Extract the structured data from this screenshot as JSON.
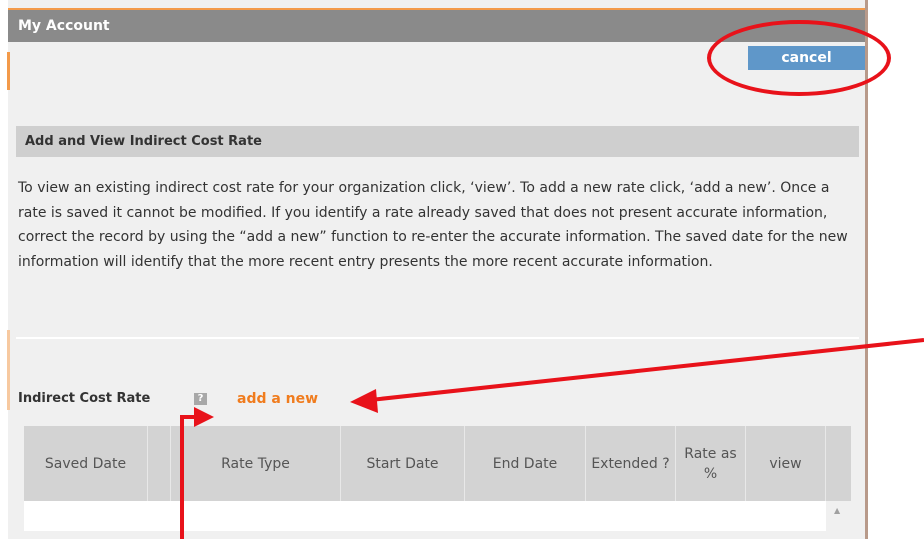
{
  "header": {
    "title": "My Account"
  },
  "toolbar": {
    "cancel_label": "cancel"
  },
  "section": {
    "title": "Add and View Indirect Cost Rate",
    "description": "To view an existing indirect cost rate for your organization click, ‘view’. To add a new rate click, ‘add a new’. Once a rate is saved it cannot be modified. If you identify a rate already saved that does not present accurate information, correct the record by using the “add a new” function to re-enter the accurate information. The saved date for the new information will identify that the more recent entry presents the more recent accurate information."
  },
  "rates": {
    "label": "Indirect Cost Rate",
    "help_icon": "?",
    "add_new_label": "add a new"
  },
  "table": {
    "columns": [
      "Saved Date",
      "",
      "Rate Type",
      "Start Date",
      "End Date",
      "Extended ?",
      "Rate as %",
      "view",
      ""
    ],
    "rows": []
  },
  "colors": {
    "header_bg": "#8a8a8a",
    "accent_orange": "#f07c1e",
    "button_blue": "#5f97c9",
    "annotation_red": "#e8121a"
  },
  "icons": [
    "help-icon",
    "scroll-up-arrow-icon"
  ]
}
